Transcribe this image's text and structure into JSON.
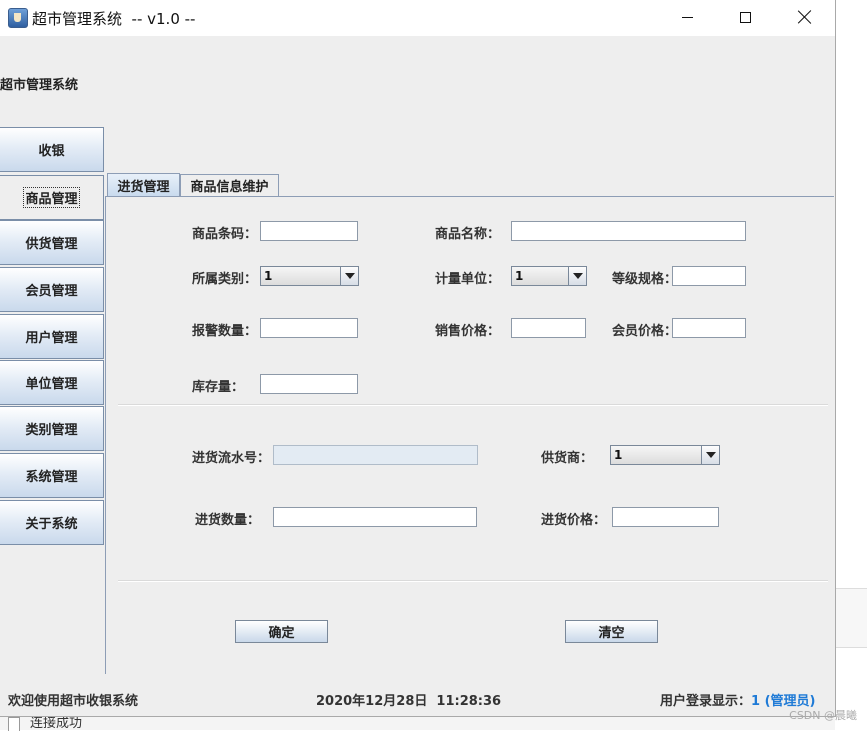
{
  "window": {
    "title": "超市管理系统  -- v1.0 --",
    "accent_color": "#1e7ad6"
  },
  "app": {
    "title": "超市管理系统"
  },
  "sidebar": {
    "items": [
      {
        "label": "收银"
      },
      {
        "label": "商品管理"
      },
      {
        "label": "供货管理"
      },
      {
        "label": "会员管理"
      },
      {
        "label": "用户管理"
      },
      {
        "label": "单位管理"
      },
      {
        "label": "类别管理"
      },
      {
        "label": "系统管理"
      },
      {
        "label": "关于系统"
      }
    ],
    "selected": "商品管理"
  },
  "tabs": [
    {
      "label": "进货管理",
      "active": true
    },
    {
      "label": "商品信息维护",
      "active": false
    }
  ],
  "form": {
    "barcode_label": "商品条码：",
    "name_label": "商品名称：",
    "category_label": "所属类别：",
    "category_value": "1",
    "unit_label": "计量单位：",
    "unit_value": "1",
    "grade_label": "等级规格：",
    "alarm_label": "报警数量：",
    "price_label": "销售价格：",
    "member_price_label": "会员价格：",
    "stock_label": "库存量：",
    "serial_label": "进货流水号：",
    "supplier_label": "供货商：",
    "supplier_value": "1",
    "qty_label": "进货数量：",
    "purchase_price_label": "进货价格："
  },
  "buttons": {
    "confirm": "确定",
    "clear": "清空"
  },
  "status": {
    "welcome": "欢迎使用超市收银系统",
    "datetime": "2020年12月28日  11:28:36",
    "user_label": "用户登录显示：",
    "user_value": "1 (管理员)"
  },
  "background_window": {
    "line1": "连接成功"
  },
  "watermark": "CSDN @晨曦"
}
